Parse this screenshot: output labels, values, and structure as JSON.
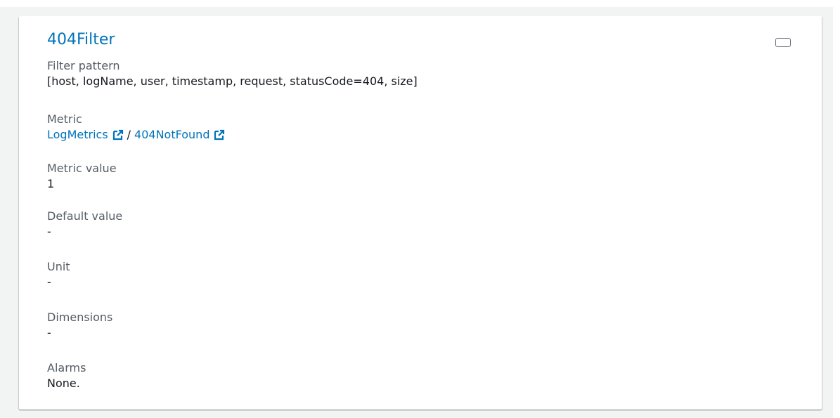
{
  "card": {
    "title": "404Filter"
  },
  "fields": {
    "filter_pattern": {
      "label": "Filter pattern",
      "value": "[host, logName, user, timestamp, request, statusCode=404, size]"
    },
    "metric": {
      "label": "Metric",
      "namespace_link": "LogMetrics",
      "separator": "/",
      "name_link": "404NotFound"
    },
    "metric_value": {
      "label": "Metric value",
      "value": "1"
    },
    "default_value": {
      "label": "Default value",
      "value": "-"
    },
    "unit": {
      "label": "Unit",
      "value": "-"
    },
    "dimensions": {
      "label": "Dimensions",
      "value": "-"
    },
    "alarms": {
      "label": "Alarms",
      "value": "None."
    }
  },
  "icons": {
    "external_link": "external-link-icon"
  },
  "colors": {
    "link": "#0073bb",
    "label": "#545b64",
    "text": "#16191f",
    "background": "#f2f3f3"
  }
}
